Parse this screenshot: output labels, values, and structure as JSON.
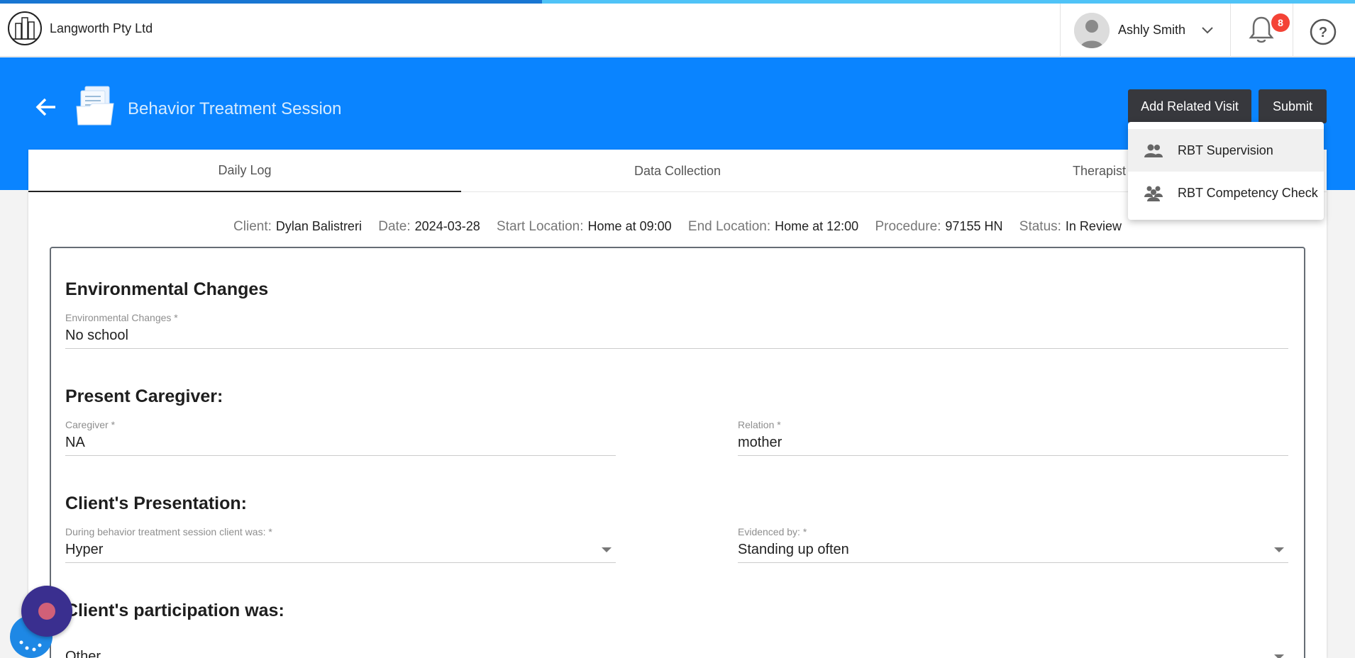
{
  "app": {
    "company": "Langworth Pty Ltd",
    "progress_percent": 40
  },
  "user": {
    "name": "Ashly Smith"
  },
  "notifications": {
    "count": "8"
  },
  "page": {
    "title": "Behavior Treatment Session"
  },
  "actions": {
    "add_related_visit": "Add Related Visit",
    "submit": "Submit"
  },
  "menu": {
    "items": [
      {
        "label": "RBT Supervision",
        "icon": "people-icon"
      },
      {
        "label": "RBT Competency Check",
        "icon": "people-group-icon"
      }
    ]
  },
  "tabs": [
    {
      "label": "Daily Log",
      "active": true
    },
    {
      "label": "Data Collection",
      "active": false
    },
    {
      "label": "Therapist Sig",
      "active": false
    }
  ],
  "session_info": {
    "client_label": "Client:",
    "client": "Dylan Balistreri",
    "date_label": "Date:",
    "date": "2024-03-28",
    "start_label": "Start Location:",
    "start": "Home at 09:00",
    "end_label": "End Location:",
    "end": "Home at 12:00",
    "procedure_label": "Procedure:",
    "procedure": "97155 HN",
    "status_label": "Status:",
    "status": "In Review"
  },
  "form": {
    "env": {
      "title": "Environmental Changes",
      "label": "Environmental Changes *",
      "value": "No school"
    },
    "caregiver": {
      "title": "Present Caregiver:",
      "caregiver_label": "Caregiver *",
      "caregiver_value": "NA",
      "relation_label": "Relation *",
      "relation_value": "mother"
    },
    "presentation": {
      "title": "Client's Presentation:",
      "during_label": "During behavior treatment session client was: *",
      "during_value": "Hyper",
      "evidenced_label": "Evidenced by: *",
      "evidenced_value": "Standing up often"
    },
    "participation": {
      "title": "Client's participation was:",
      "value": "Other"
    }
  },
  "colors": {
    "header_blue": "#0a84ff",
    "button_dark": "#37383d",
    "badge_red": "#f44336"
  }
}
